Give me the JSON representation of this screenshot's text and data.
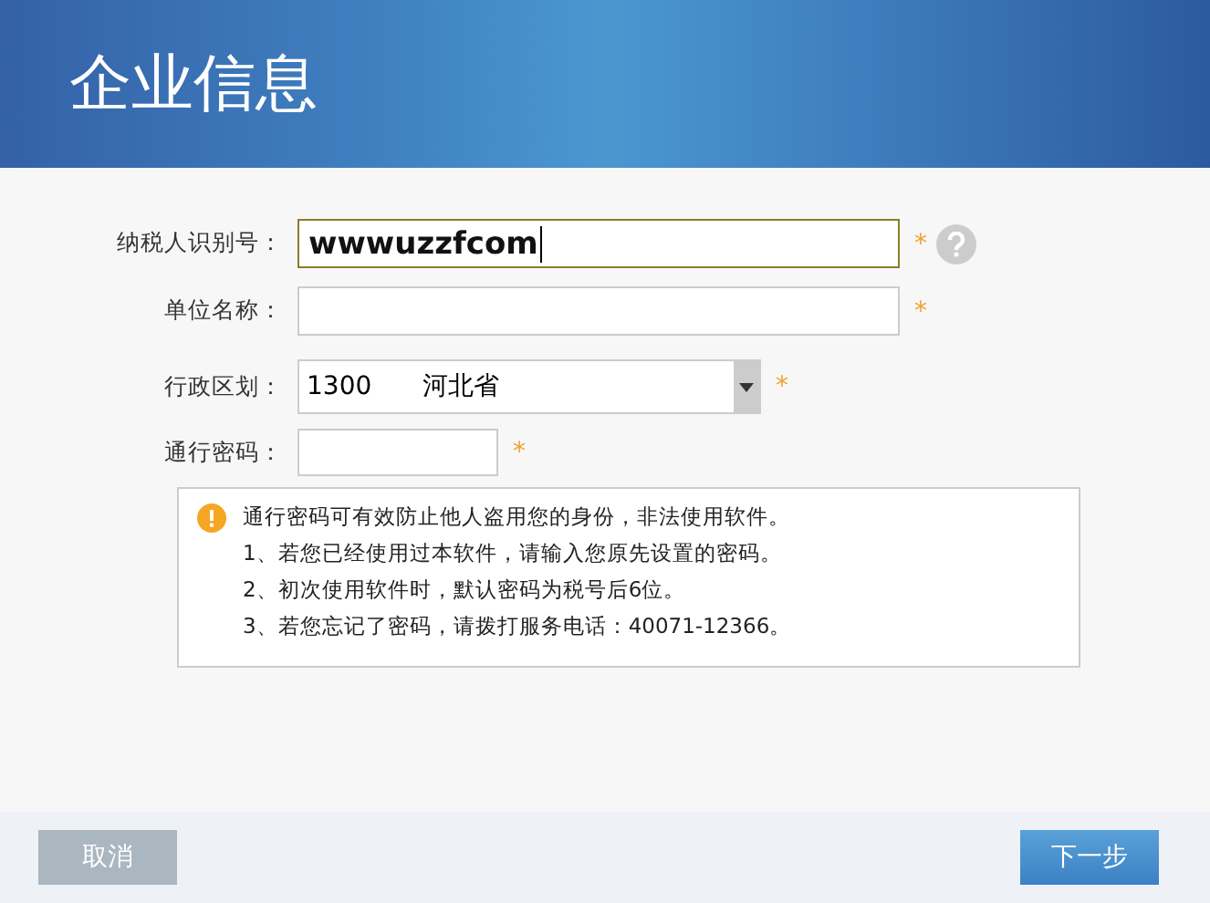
{
  "window": {
    "title": "企业信息"
  },
  "fields": [
    {
      "kind": "text",
      "label": "纳税人识别号：",
      "value": "wwwuzzfcom",
      "required_mark": "*",
      "focused": true,
      "help": true
    },
    {
      "kind": "text",
      "label": "单位名称：",
      "required_mark": "*",
      "focused": false,
      "help": false
    },
    {
      "kind": "select",
      "label": "行政区划：",
      "code": "1300",
      "value": "河北省",
      "required_mark": "*",
      "help": false
    },
    {
      "kind": "password",
      "label": "通行密码：",
      "required_mark": "*",
      "focused": false,
      "help": false
    }
  ],
  "notice": {
    "heading": "通行密码可有效防止他人盗用您的身份，非法使用软件。",
    "lines": [
      "1、若您已经使用过本软件，请输入您原先设置的密码。",
      "2、初次使用软件时，默认密码为税号后6位。",
      "3、若您忘记了密码，请拨打服务电话：40071-12366。"
    ]
  },
  "buttons": [
    {
      "kind": "secondary",
      "label": "取消"
    },
    {
      "kind": "primary",
      "label": "下一步"
    }
  ]
}
